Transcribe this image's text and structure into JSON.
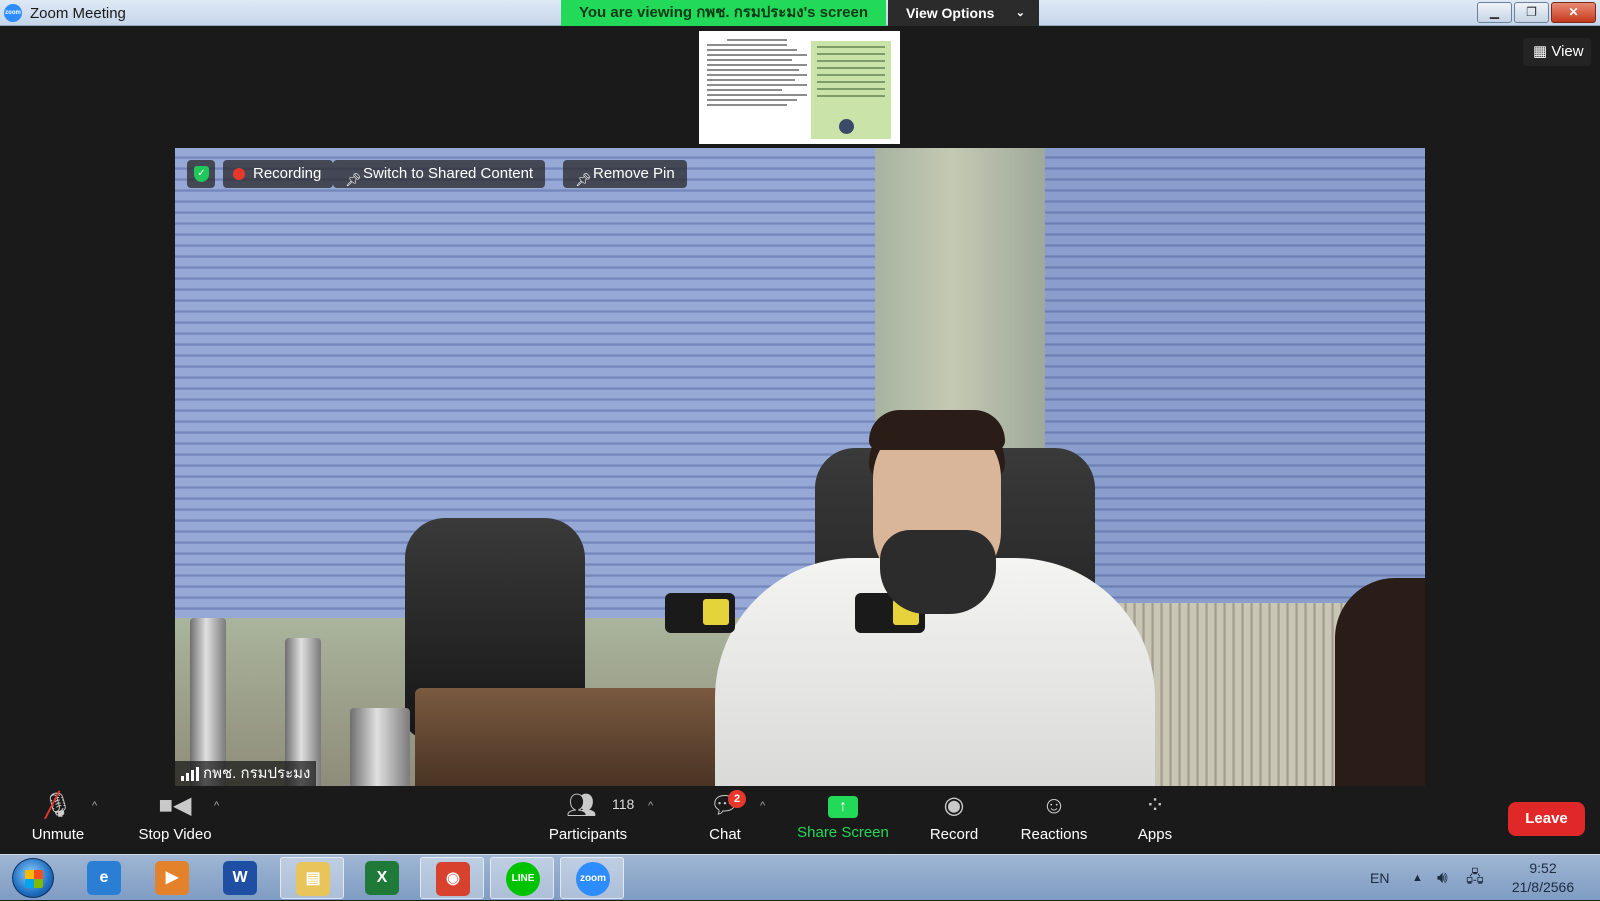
{
  "window": {
    "title": "Zoom Meeting",
    "logo_text": "zoom",
    "viewing_banner": "You are viewing กพช. กรมประมง's screen",
    "view_options_label": "View Options",
    "minimize_glyph": "▁",
    "restore_glyph": "❐",
    "close_glyph": "✕"
  },
  "view_button": {
    "label": "View",
    "icon": "grid-icon"
  },
  "video_tools": {
    "shield_glyph": "✓",
    "recording_label": "Recording",
    "switch_label": "Switch to Shared Content",
    "remove_pin_label": "Remove Pin"
  },
  "participant": {
    "name": "กพช. กรมประมง"
  },
  "toolbar": {
    "unmute_label": "Unmute",
    "stop_video_label": "Stop Video",
    "participants_label": "Participants",
    "participants_count": "118",
    "chat_label": "Chat",
    "chat_badge": "2",
    "share_screen_label": "Share Screen",
    "record_label": "Record",
    "reactions_label": "Reactions",
    "apps_label": "Apps",
    "leave_label": "Leave",
    "colors": {
      "share_green": "#23d959",
      "leave_red": "#e02828"
    }
  },
  "taskbar": {
    "apps": [
      {
        "name": "internet-explorer-icon",
        "glyph": "e",
        "color": "#2a7fd4"
      },
      {
        "name": "media-player-icon",
        "glyph": "▶",
        "color": "#e3822b"
      },
      {
        "name": "word-icon",
        "glyph": "W",
        "color": "#1f4fa3"
      },
      {
        "name": "file-explorer-icon",
        "glyph": "▤",
        "color": "#e8c45a"
      },
      {
        "name": "excel-icon",
        "glyph": "X",
        "color": "#1f7a3a"
      },
      {
        "name": "chrome-icon",
        "glyph": "◉",
        "color": "#d9412f"
      },
      {
        "name": "line-icon",
        "glyph": "LINE",
        "color": "#00c300"
      },
      {
        "name": "zoom-icon",
        "glyph": "zoom",
        "color": "#2d8cff"
      }
    ],
    "language": "EN",
    "time": "9:52",
    "date": "21/8/2566"
  }
}
